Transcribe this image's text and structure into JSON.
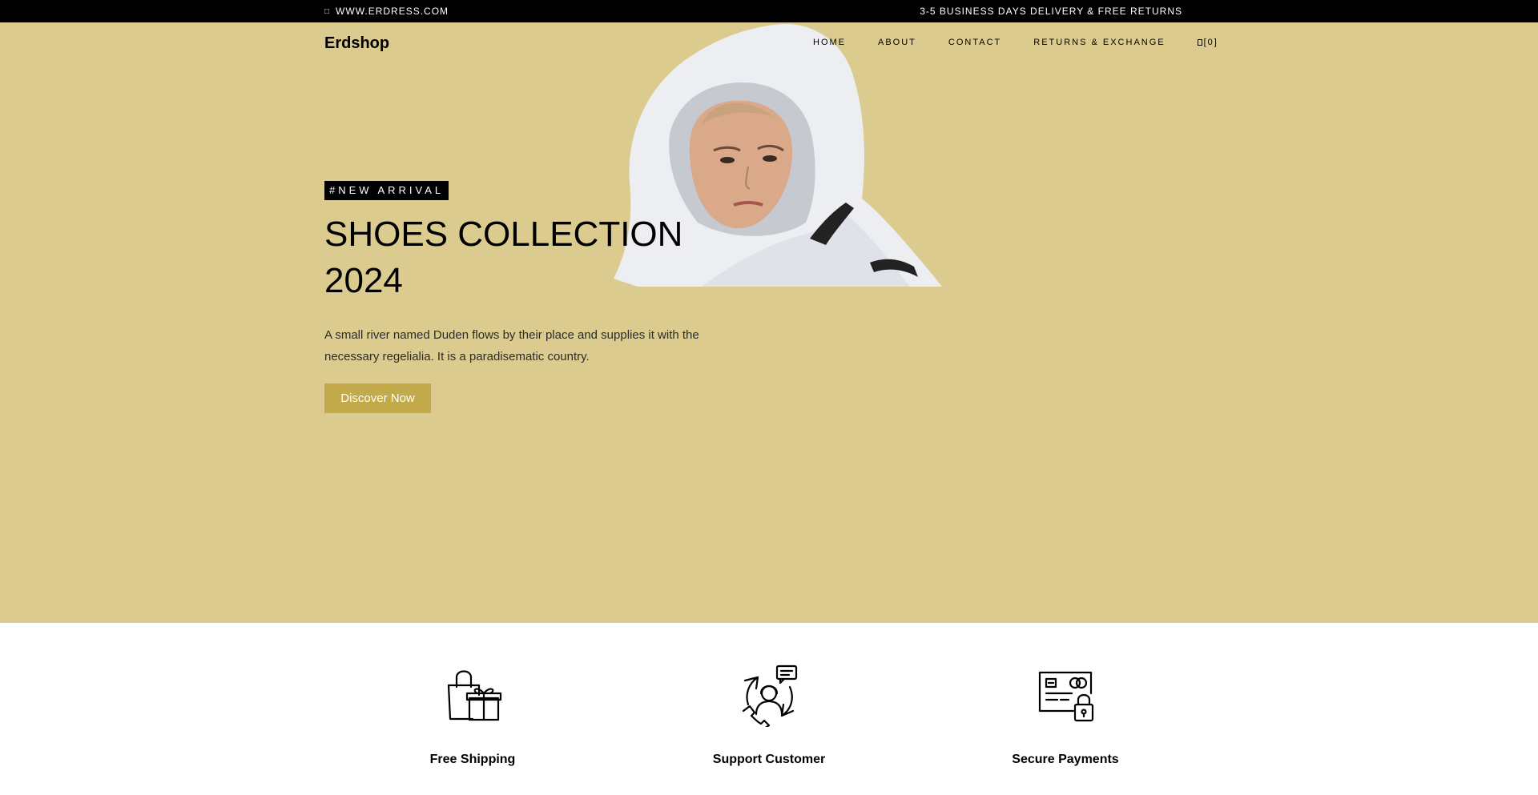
{
  "topbar": {
    "website": "WWW.ERDRESS.COM",
    "promo": "3-5 BUSINESS DAYS DELIVERY & FREE RETURNS"
  },
  "header": {
    "brand": "Erdshop",
    "nav": [
      "HOME",
      "ABOUT",
      "CONTACT",
      "RETURNS & EXCHANGE"
    ],
    "cart_label": "[0]"
  },
  "hero": {
    "tag": "#NEW ARRIVAL",
    "title_line1": "SHOES COLLECTION",
    "title_line2": "2024",
    "description": "A small river named Duden flows by their place and supplies it with the necessary regelialia. It is a paradisematic country.",
    "cta_label": "Discover Now",
    "background_color": "#dbcb8e",
    "button_color": "#c2a94a"
  },
  "features": [
    {
      "title": "Free Shipping",
      "icon": "shopping-bag-gift-icon"
    },
    {
      "title": "Support Customer",
      "icon": "customer-support-icon"
    },
    {
      "title": "Secure Payments",
      "icon": "secure-card-icon"
    }
  ]
}
